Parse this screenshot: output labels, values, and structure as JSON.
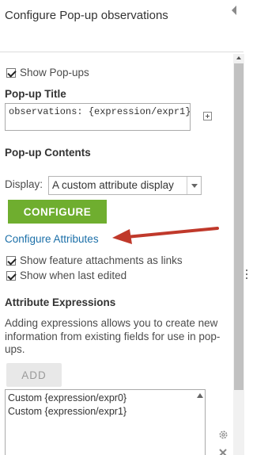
{
  "header": {
    "title": "Configure Pop-up observations"
  },
  "show_popups": {
    "label": "Show Pop-ups",
    "checked": true
  },
  "popup_title": {
    "heading": "Pop-up Title",
    "value": "observations: {expression/expr1}"
  },
  "popup_contents": {
    "heading": "Pop-up Contents",
    "display_label": "Display:",
    "display_value": "A custom attribute display",
    "configure_label": "CONFIGURE",
    "configure_attributes_link": "Configure Attributes",
    "show_attachments_label": "Show feature attachments as links",
    "show_attachments_checked": true,
    "show_last_edited_label": "Show when last edited",
    "show_last_edited_checked": true
  },
  "attribute_expressions": {
    "heading": "Attribute Expressions",
    "description": "Adding expressions allows you to create new information from existing fields for use in pop-ups.",
    "add_label": "ADD",
    "items": [
      "Custom {expression/expr0}",
      "Custom {expression/expr1}"
    ]
  },
  "colors": {
    "configure_button": "#6fae2f",
    "link": "#1b6fa8",
    "annotation_arrow": "#c0392b"
  }
}
